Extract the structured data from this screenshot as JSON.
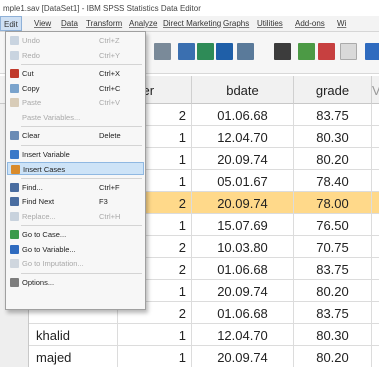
{
  "window": {
    "title": "mple1.sav [DataSet1] - IBM SPSS Statistics Data Editor"
  },
  "menubar": [
    "Edit",
    "View",
    "Data",
    "Transform",
    "Analyze",
    "Direct Marketing",
    "Graphs",
    "Utilities",
    "Add-ons",
    "Wi"
  ],
  "edit_menu": [
    {
      "label": "Undo",
      "shortcut": "Ctrl+Z",
      "enabled": false,
      "icon": "undo-icon"
    },
    {
      "label": "Redo",
      "shortcut": "Ctrl+Y",
      "enabled": false,
      "icon": "redo-icon"
    },
    {
      "label": "Cut",
      "shortcut": "Ctrl+X",
      "enabled": true,
      "icon": "cut-icon"
    },
    {
      "label": "Copy",
      "shortcut": "Ctrl+C",
      "enabled": true,
      "icon": "copy-icon"
    },
    {
      "label": "Paste",
      "shortcut": "Ctrl+V",
      "enabled": false,
      "icon": "paste-icon"
    },
    {
      "label": "Paste Variables...",
      "shortcut": "",
      "enabled": false,
      "icon": ""
    },
    {
      "label": "Clear",
      "shortcut": "Delete",
      "enabled": true,
      "icon": "clear-icon"
    },
    {
      "label": "Insert Variable",
      "shortcut": "",
      "enabled": true,
      "icon": "insert-variable-icon"
    },
    {
      "label": "Insert Cases",
      "shortcut": "",
      "enabled": true,
      "icon": "insert-cases-icon",
      "highlighted": true
    },
    {
      "label": "Find...",
      "shortcut": "Ctrl+F",
      "enabled": true,
      "icon": "find-icon"
    },
    {
      "label": "Find Next",
      "shortcut": "F3",
      "enabled": true,
      "icon": "find-next-icon"
    },
    {
      "label": "Replace...",
      "shortcut": "Ctrl+H",
      "enabled": false,
      "icon": "replace-icon"
    },
    {
      "label": "Go to Case...",
      "shortcut": "",
      "enabled": true,
      "icon": "go-to-case-icon"
    },
    {
      "label": "Go to Variable...",
      "shortcut": "",
      "enabled": true,
      "icon": "go-to-variable-icon"
    },
    {
      "label": "Go to Imputation...",
      "shortcut": "",
      "enabled": false,
      "icon": "go-to-imputation-icon"
    },
    {
      "label": "Options...",
      "shortcut": "",
      "enabled": true,
      "icon": "options-icon"
    }
  ],
  "grid": {
    "columns": [
      "nder",
      "bdate",
      "grade",
      "Va"
    ],
    "rows": [
      {
        "name": "",
        "gender": "2",
        "bdate": "01.06.68",
        "grade": "83.75"
      },
      {
        "name": "",
        "gender": "1",
        "bdate": "12.04.70",
        "grade": "80.30"
      },
      {
        "name": "",
        "gender": "1",
        "bdate": "20.09.74",
        "grade": "80.20"
      },
      {
        "name": "",
        "gender": "1",
        "bdate": "05.01.67",
        "grade": "78.40"
      },
      {
        "name": "",
        "gender": "2",
        "bdate": "20.09.74",
        "grade": "78.00",
        "selected": true
      },
      {
        "name": "",
        "gender": "1",
        "bdate": "15.07.69",
        "grade": "76.50"
      },
      {
        "name": "",
        "gender": "2",
        "bdate": "10.03.80",
        "grade": "70.75"
      },
      {
        "name": "",
        "gender": "2",
        "bdate": "01.06.68",
        "grade": "83.75"
      },
      {
        "name": "",
        "gender": "1",
        "bdate": "20.09.74",
        "grade": "80.20"
      },
      {
        "name": "",
        "gender": "2",
        "bdate": "01.06.68",
        "grade": "83.75"
      },
      {
        "name": "khalid",
        "gender": "1",
        "bdate": "12.04.70",
        "grade": "80.30"
      },
      {
        "name": "majed",
        "gender": "1",
        "bdate": "20.09.74",
        "grade": "80.20"
      }
    ]
  },
  "colors": {
    "selected_row": "#ffd98a",
    "menu_highlight": "#cde3f7",
    "accent": "#3a78c8"
  }
}
